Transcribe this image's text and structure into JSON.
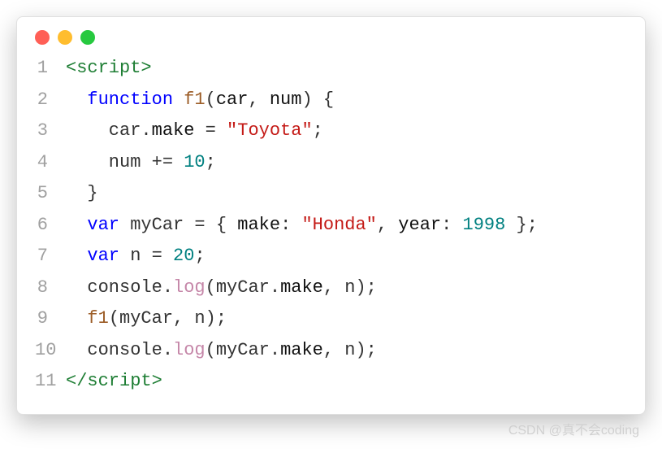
{
  "watermark": "CSDN @真不会coding",
  "code": {
    "lines": [
      {
        "num": "1",
        "tokens": [
          {
            "t": "<script>",
            "c": "t-tag"
          }
        ]
      },
      {
        "num": "2",
        "tokens": [
          {
            "t": "  ",
            "c": "t-default"
          },
          {
            "t": "function",
            "c": "t-keyword"
          },
          {
            "t": " ",
            "c": "t-default"
          },
          {
            "t": "f1",
            "c": "t-func"
          },
          {
            "t": "(",
            "c": "t-default"
          },
          {
            "t": "car",
            "c": "t-param"
          },
          {
            "t": ", ",
            "c": "t-default"
          },
          {
            "t": "num",
            "c": "t-param"
          },
          {
            "t": ") {",
            "c": "t-default"
          }
        ]
      },
      {
        "num": "3",
        "tokens": [
          {
            "t": "    car",
            "c": "t-default"
          },
          {
            "t": ".",
            "c": "t-default"
          },
          {
            "t": "make",
            "c": "t-prop"
          },
          {
            "t": " = ",
            "c": "t-default"
          },
          {
            "t": "\"Toyota\"",
            "c": "t-string"
          },
          {
            "t": ";",
            "c": "t-default"
          }
        ]
      },
      {
        "num": "4",
        "tokens": [
          {
            "t": "    num += ",
            "c": "t-default"
          },
          {
            "t": "10",
            "c": "t-number"
          },
          {
            "t": ";",
            "c": "t-default"
          }
        ]
      },
      {
        "num": "5",
        "tokens": [
          {
            "t": "  }",
            "c": "t-default"
          }
        ]
      },
      {
        "num": "6",
        "tokens": [
          {
            "t": "  ",
            "c": "t-default"
          },
          {
            "t": "var",
            "c": "t-keyword"
          },
          {
            "t": " myCar = { ",
            "c": "t-default"
          },
          {
            "t": "make",
            "c": "t-prop"
          },
          {
            "t": ": ",
            "c": "t-default"
          },
          {
            "t": "\"Honda\"",
            "c": "t-string"
          },
          {
            "t": ", ",
            "c": "t-default"
          },
          {
            "t": "year",
            "c": "t-prop"
          },
          {
            "t": ": ",
            "c": "t-default"
          },
          {
            "t": "1998",
            "c": "t-number"
          },
          {
            "t": " };",
            "c": "t-default"
          }
        ]
      },
      {
        "num": "7",
        "tokens": [
          {
            "t": "  ",
            "c": "t-default"
          },
          {
            "t": "var",
            "c": "t-keyword"
          },
          {
            "t": " n = ",
            "c": "t-default"
          },
          {
            "t": "20",
            "c": "t-number"
          },
          {
            "t": ";",
            "c": "t-default"
          }
        ]
      },
      {
        "num": "8",
        "tokens": [
          {
            "t": "  console.",
            "c": "t-default"
          },
          {
            "t": "log",
            "c": "t-method"
          },
          {
            "t": "(myCar.",
            "c": "t-default"
          },
          {
            "t": "make",
            "c": "t-prop"
          },
          {
            "t": ", n);",
            "c": "t-default"
          }
        ]
      },
      {
        "num": "9",
        "tokens": [
          {
            "t": "  ",
            "c": "t-default"
          },
          {
            "t": "f1",
            "c": "t-func"
          },
          {
            "t": "(myCar, n);",
            "c": "t-default"
          }
        ]
      },
      {
        "num": "10",
        "tokens": [
          {
            "t": "  console.",
            "c": "t-default"
          },
          {
            "t": "log",
            "c": "t-method"
          },
          {
            "t": "(myCar.",
            "c": "t-default"
          },
          {
            "t": "make",
            "c": "t-prop"
          },
          {
            "t": ", n);",
            "c": "t-default"
          }
        ]
      },
      {
        "num": "11",
        "tokens": [
          {
            "t": "</script>",
            "c": "t-tag"
          }
        ]
      }
    ]
  }
}
